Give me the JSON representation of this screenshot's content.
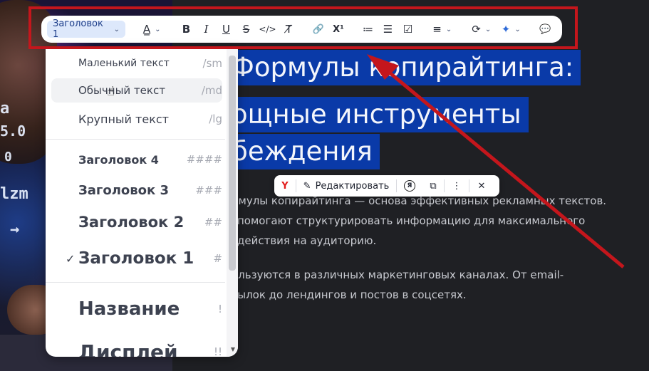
{
  "toolbar": {
    "style_select": "Заголовок 1",
    "items": [
      {
        "name": "text-color",
        "icon": "A̲",
        "chev": true
      },
      {
        "name": "bold",
        "icon": "B"
      },
      {
        "name": "italic",
        "icon": "I"
      },
      {
        "name": "underline",
        "icon": "U"
      },
      {
        "name": "strikethrough",
        "icon": "S"
      },
      {
        "name": "code",
        "icon": "</>"
      },
      {
        "name": "clear-format",
        "icon": "T̸"
      },
      {
        "name": "link",
        "icon": "🔗"
      },
      {
        "name": "superscript",
        "icon": "X¹"
      },
      {
        "name": "numbered-list",
        "icon": "≔"
      },
      {
        "name": "bullet-list",
        "icon": "☰"
      },
      {
        "name": "checklist",
        "icon": "☑"
      },
      {
        "name": "align",
        "icon": "≡",
        "chev": true
      },
      {
        "name": "convert",
        "icon": "⟳",
        "chev": true
      },
      {
        "name": "ai-sparkle",
        "icon": "✦",
        "chev": true
      },
      {
        "name": "comment",
        "icon": "💬"
      }
    ]
  },
  "dropdown": {
    "items": [
      {
        "label": "Маленький текст",
        "shortcut": "/sm",
        "size": 14,
        "weight": "normal"
      },
      {
        "label": "Обычный текст",
        "shortcut": "/md",
        "size": 15,
        "weight": "normal",
        "hover": true
      },
      {
        "label": "Крупный текст",
        "shortcut": "/lg",
        "size": 16,
        "weight": "normal"
      },
      {
        "label": "Заголовок 4",
        "shortcut": "####",
        "size": 16,
        "weight": "bold"
      },
      {
        "label": "Заголовок 3",
        "shortcut": "###",
        "size": 18,
        "weight": "bold"
      },
      {
        "label": "Заголовок 2",
        "shortcut": "##",
        "size": 21,
        "weight": "bold"
      },
      {
        "label": "Заголовок 1",
        "shortcut": "#",
        "size": 23,
        "weight": "bold",
        "checked": true
      },
      {
        "label": "Название",
        "shortcut": "!",
        "size": 26,
        "weight": "bold"
      },
      {
        "label": "Дисплей",
        "shortcut": "!!",
        "size": 28,
        "weight": "bold"
      }
    ]
  },
  "document": {
    "title_lines": [
      "Формулы копирайтинга:",
      "ощные инструменты",
      "беждения"
    ],
    "para1": [
      "рмулы копирайтинга — основа эффективных рекламных текстов.",
      "помогают структурировать информацию для максимального",
      "действия на аудиторию."
    ],
    "para2": [
      "ользуются в различных маркетинговых каналах. От email-",
      "сылок до лендингов и постов в соцсетях."
    ]
  },
  "context_bar": {
    "yandex_icon": "Y",
    "edit_label": "Редактировать",
    "alice_icon": "Я",
    "copy_icon": "⧉",
    "more_icon": "⋮",
    "close_icon": "✕"
  },
  "photo": {
    "glyphs": [
      "a",
      "5.0",
      "0",
      "lzm",
      "→"
    ]
  },
  "colors": {
    "highlight": "#c4161c",
    "selection": "#0a3aa8",
    "select_bg": "#dde8fb"
  }
}
